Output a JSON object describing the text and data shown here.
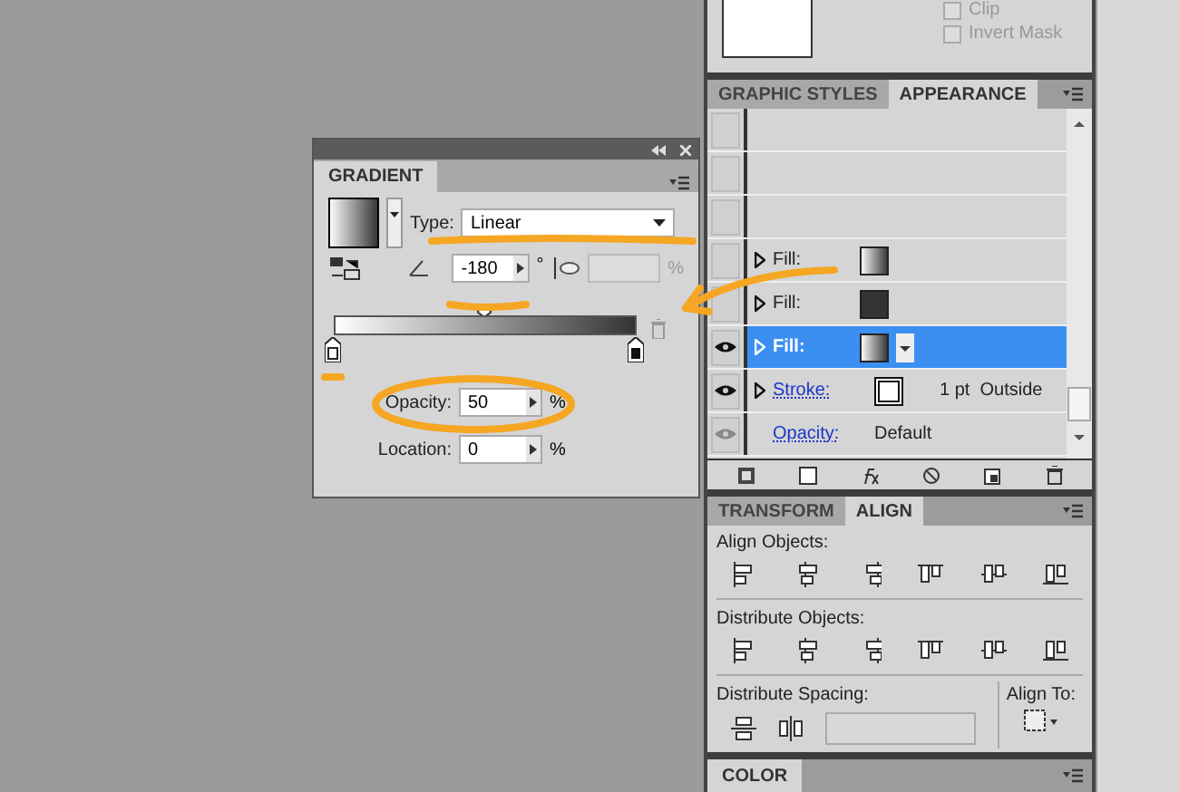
{
  "mask_options": {
    "checkboxes": [
      {
        "label": "Clip",
        "checked": false
      },
      {
        "label": "Invert Mask",
        "checked": false
      }
    ]
  },
  "gradient_panel": {
    "tab": "GRADIENT",
    "type_label": "Type:",
    "type_value": "Linear",
    "angle_value": "-180",
    "degree_sign": "°",
    "aspect_unit": "%",
    "opacity_label": "Opacity:",
    "opacity_value": "50",
    "opacity_unit": "%",
    "location_label": "Location:",
    "location_value": "0",
    "location_unit": "%"
  },
  "appearance_panel": {
    "tabs": [
      {
        "label": "GRAPHIC STYLES",
        "selected": false
      },
      {
        "label": "APPEARANCE",
        "selected": true
      }
    ],
    "rows": [
      {
        "kind": "blank"
      },
      {
        "kind": "blank"
      },
      {
        "kind": "blank"
      },
      {
        "kind": "fill",
        "label": "Fill:",
        "swatch": {
          "kind": "gradient"
        },
        "visible": false,
        "selected": false
      },
      {
        "kind": "fill",
        "label": "Fill:",
        "swatch": {
          "kind": "solid"
        },
        "visible": false,
        "selected": false
      },
      {
        "kind": "fill",
        "label": "Fill:",
        "swatch": {
          "kind": "gradient"
        },
        "visible": true,
        "dimmed": false,
        "selected": true
      },
      {
        "kind": "stroke",
        "label": "Stroke:",
        "swatch": {
          "kind": "stroke"
        },
        "detail": "1 pt  Outside",
        "visible": true,
        "dimmed": false,
        "selected": false
      },
      {
        "kind": "attribute",
        "label": "Opacity:",
        "value": "Default",
        "visible": true,
        "dimmed": true,
        "selected": false
      }
    ]
  },
  "align_panel": {
    "tabs": [
      {
        "label": "TRANSFORM",
        "selected": false
      },
      {
        "label": "ALIGN",
        "selected": true
      }
    ],
    "align_objects": "Align Objects:",
    "distribute_objects": "Distribute Objects:",
    "distribute_spacing": "Distribute Spacing:",
    "align_to": "Align To:"
  },
  "color_panel": {
    "tab": "COLOR"
  }
}
